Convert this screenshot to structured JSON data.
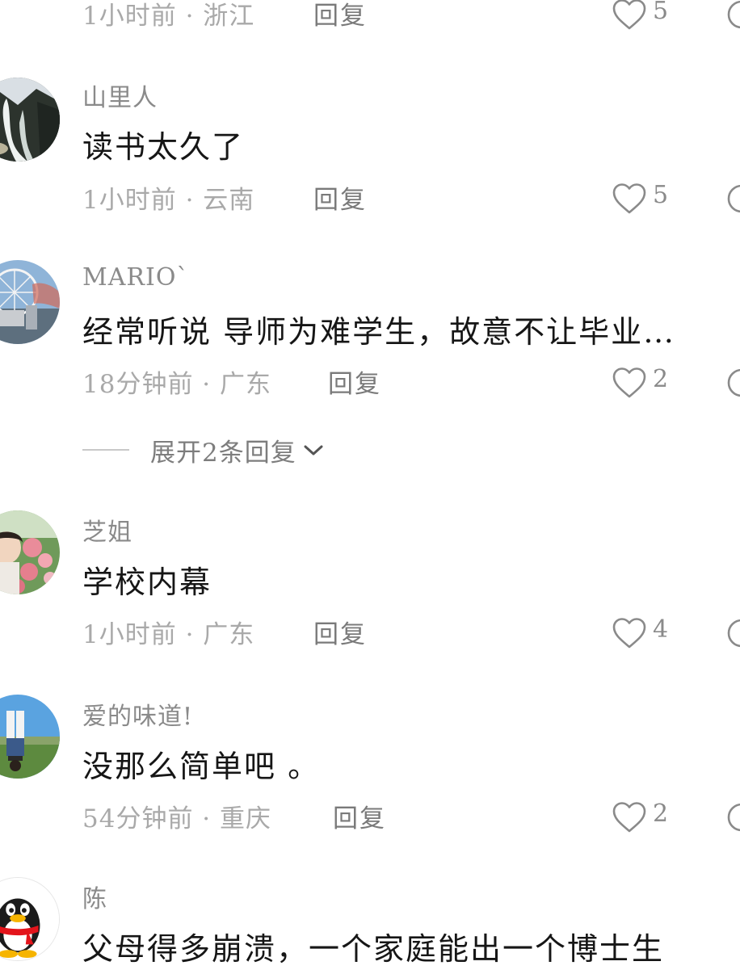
{
  "comments": [
    {
      "name": "",
      "text": "",
      "time": "1小时前 · 浙江",
      "reply": "回复",
      "likes": "5",
      "avatar": "none"
    },
    {
      "name": "山里人",
      "text": "读书太久了",
      "time": "1小时前 · 云南",
      "reply": "回复",
      "likes": "5",
      "avatar": "waterfall-photo"
    },
    {
      "name": "MARIO`",
      "text": "经常听说 导师为难学生，故意不让毕业…",
      "time": "18分钟前 · 广东",
      "reply": "回复",
      "likes": "2",
      "avatar": "ferris-wheel-photo",
      "expand_label": "展开2条回复"
    },
    {
      "name": "芝姐",
      "text": "学校内幕",
      "time": "1小时前 · 广东",
      "reply": "回复",
      "likes": "4",
      "avatar": "flowers-photo"
    },
    {
      "name": "爱的味道!",
      "text": "没那么简单吧 。",
      "time": "54分钟前 · 重庆",
      "reply": "回复",
      "likes": "2",
      "avatar": "handstand-photo"
    },
    {
      "name": "陈",
      "text": "父母得多崩溃，一个家庭能出一个博士生",
      "time": "",
      "reply": "",
      "likes": "",
      "avatar": "qq-penguin"
    }
  ],
  "colors": {
    "name": "#8a8a8a",
    "text": "#161616",
    "meta": "#a9a9a9",
    "reply": "#7a7a7a",
    "icon": "#8a8a8a"
  },
  "icons": {
    "like": "heart-outline-icon",
    "dislike": "dislike-icon",
    "expand": "chevron-down-icon"
  }
}
